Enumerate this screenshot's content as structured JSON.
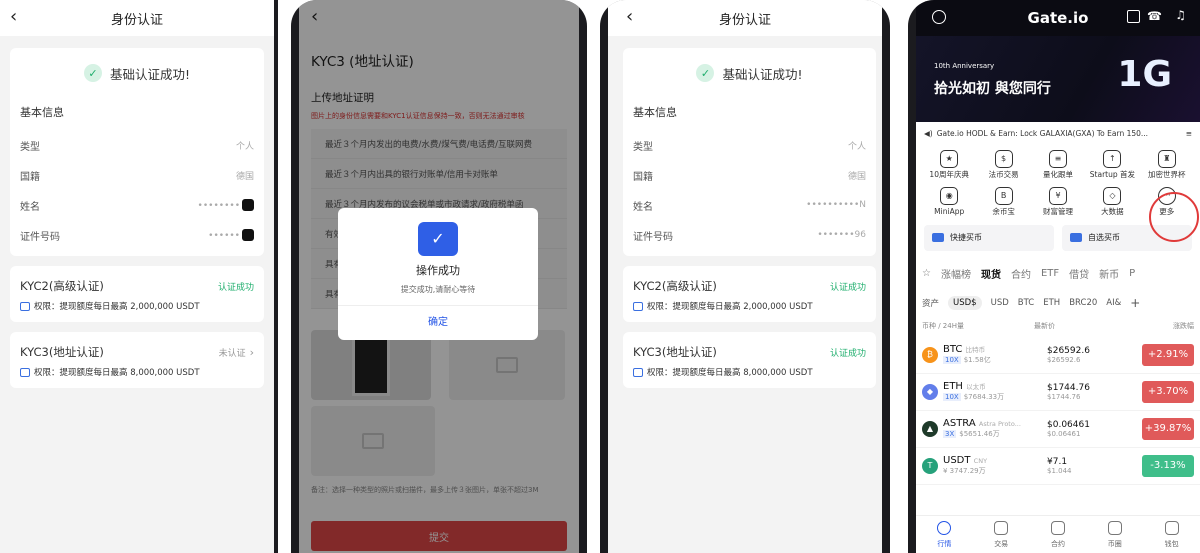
{
  "phone1": {
    "header_title": "身份认证",
    "success_text": "基础认证成功!",
    "basic_section": "基本信息",
    "rows": [
      {
        "label": "类型",
        "value": "个人"
      },
      {
        "label": "国籍",
        "value": "德国"
      },
      {
        "label": "姓名",
        "value": "••••••••"
      },
      {
        "label": "证件号码",
        "value": "••••••"
      }
    ],
    "kyc2": {
      "title": "KYC2(高级认证)",
      "status": "认证成功",
      "limit": "权限：提现额度每日最高 2,000,000 USDT"
    },
    "kyc3": {
      "title": "KYC3(地址认证)",
      "status": "未认证",
      "limit": "权限：提现额度每日最高 8,000,000 USDT"
    }
  },
  "phone2": {
    "title": "KYC3 (地址认证)",
    "upload_title": "上传地址证明",
    "warning": "图片上的身份信息需要和KYC1认证信息保持一致，否则无法通过审核",
    "options": [
      "最近３个月内发出的电费/水费/煤气费/电话费/互联网费",
      "最近３个月内出具的银行对账单/信用卡对账单",
      "最近３个月内发布的议会税单或市政请求/政府税单函",
      "有效",
      "具有",
      "具有"
    ],
    "note": "备注：选择一种类型的照片或扫描件，最多上传３张图片，单张不超过3M",
    "submit": "提交",
    "dialog": {
      "title": "操作成功",
      "message": "提交成功,请耐心等待",
      "confirm": "确定"
    }
  },
  "phone3": {
    "header_title": "身份认证",
    "success_text": "基础认证成功!",
    "basic_section": "基本信息",
    "rows": [
      {
        "label": "类型",
        "value": "个人"
      },
      {
        "label": "国籍",
        "value": "德国"
      },
      {
        "label": "姓名",
        "value": "••••••••••N"
      },
      {
        "label": "证件号码",
        "value": "•••••••96"
      }
    ],
    "kyc2": {
      "title": "KYC2(高级认证)",
      "status": "认证成功",
      "limit": "权限：提现额度每日最高 2,000,000 USDT"
    },
    "kyc3": {
      "title": "KYC3(地址认证)",
      "status": "认证成功",
      "limit": "权限：提现额度每日最高 8,000,000 USDT"
    }
  },
  "phone4": {
    "brand": "Gate.io",
    "banner": {
      "anniv": "10th Anniversary",
      "slogan": "拾光如初 與您同行",
      "big": "1G"
    },
    "announcement": "Gate.io HODL & Earn: Lock GALAXIA(GXA) To Earn 150...",
    "grid": [
      {
        "label": "10周年庆典",
        "icon": "gift-icon",
        "glyph": "★"
      },
      {
        "label": "法币交易",
        "icon": "currency-icon",
        "glyph": "$"
      },
      {
        "label": "量化跟单",
        "icon": "chart-icon",
        "glyph": "≡"
      },
      {
        "label": "Startup 首发",
        "icon": "startup-icon",
        "glyph": "↑"
      },
      {
        "label": "加密世界杯",
        "icon": "shield-icon",
        "glyph": "♜"
      },
      {
        "label": "MiniApp",
        "icon": "robot-icon",
        "glyph": "◉"
      },
      {
        "label": "余币宝",
        "icon": "coin-icon",
        "glyph": "B"
      },
      {
        "label": "财富管理",
        "icon": "wealth-icon",
        "glyph": "¥"
      },
      {
        "label": "大数据",
        "icon": "cube-icon",
        "glyph": "◇"
      },
      {
        "label": "更多",
        "icon": "more-icon",
        "glyph": "···"
      }
    ],
    "quick_buy": "快捷买币",
    "self_buy": "自选买币",
    "tabs": [
      "涨幅榜",
      "现货",
      "合约",
      "ETF",
      "借贷",
      "新币",
      "P"
    ],
    "active_tab": "现货",
    "subtabs": [
      "资产",
      "USD$",
      "USD",
      "BTC",
      "ETH",
      "BRC20",
      "AI&"
    ],
    "list_headers": {
      "coin": "币种 / 24H量",
      "price": "最新价",
      "change": "涨跌幅"
    },
    "coins": [
      {
        "sym": "BTC",
        "full": "比特币",
        "lev": "10X",
        "vol": "$1.58亿",
        "price": "$26592.6",
        "sub": "$26592.6",
        "chg": "+2.91%",
        "color": "#e05a5a",
        "ic": "#f7931a",
        "g": "₿"
      },
      {
        "sym": "ETH",
        "full": "以太币",
        "lev": "10X",
        "vol": "$7684.33万",
        "price": "$1744.76",
        "sub": "$1744.76",
        "chg": "+3.70%",
        "color": "#e05a5a",
        "ic": "#627eea",
        "g": "◆"
      },
      {
        "sym": "ASTRA",
        "full": "Astra Proto...",
        "lev": "3X",
        "vol": "$5651.46万",
        "price": "$0.06461",
        "sub": "$0.06461",
        "chg": "+39.87%",
        "color": "#e05a5a",
        "ic": "#1e3a2a",
        "g": "▲"
      },
      {
        "sym": "USDT",
        "full": "CNY",
        "lev": "",
        "vol": "¥ 3747.29万",
        "price": "¥7.1",
        "sub": "$1.044",
        "chg": "-3.13%",
        "color": "#3fbe8a",
        "ic": "#26a17b",
        "g": "T"
      }
    ],
    "tabbar": [
      "行情",
      "交易",
      "合约",
      "币圈",
      "钱包"
    ]
  }
}
